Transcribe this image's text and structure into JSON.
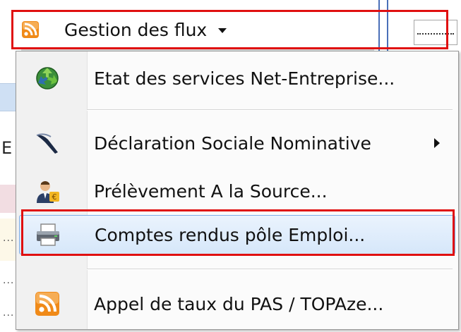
{
  "menubar": {
    "title": "Gestion des flux",
    "icon": "rss-icon",
    "dropdown_icon": "caret-down-icon"
  },
  "menu": {
    "items": [
      {
        "label": "Etat des services Net-Entreprise...",
        "icon": "recycle-globe-icon",
        "has_submenu": false
      },
      {
        "label": "Déclaration Sociale Nominative",
        "icon": "pen-nib-icon",
        "has_submenu": true
      },
      {
        "label": "Prélèvement A la Source...",
        "icon": "user-money-icon",
        "has_submenu": false
      },
      {
        "label": "Comptes rendus pôle Emploi...",
        "icon": "printer-icon",
        "has_submenu": false,
        "highlighted": true
      },
      {
        "label": "Appel de taux du PAS / TOPAze...",
        "icon": "rss-icon",
        "has_submenu": false
      }
    ]
  },
  "background": {
    "edge_letter": "E",
    "dots": "..."
  },
  "colors": {
    "annotation_red": "#e01010",
    "highlight_border": "#7eaee6",
    "rss_orange": "#f08a18"
  }
}
